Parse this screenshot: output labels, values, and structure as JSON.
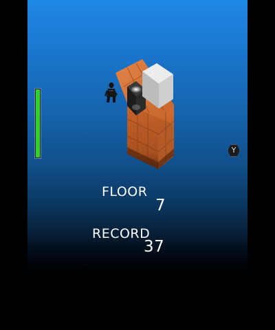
{
  "hud": {
    "floor_label": "FLOOR",
    "floor_value": "7",
    "record_label": "RECORD",
    "record_value": "37",
    "y_button_label": "Y",
    "health_fraction": 1.0
  },
  "scene": {
    "colors": {
      "sky_top": "#1f88e6",
      "sky_bottom": "#000000",
      "cube_orange": "#c9672c",
      "cube_dark": "#7a3717",
      "cube_white": "#d7d7d7",
      "cube_black": "#2a2a2a",
      "health_green": "#31d12e"
    },
    "objects": [
      "orange-block-tower",
      "white-block",
      "black-switch-block",
      "player-character"
    ]
  }
}
